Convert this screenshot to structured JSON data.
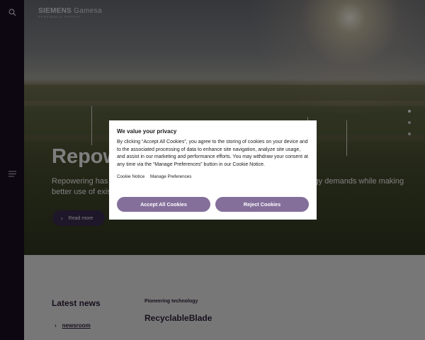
{
  "logo": {
    "brand_bold": "SIEMENS",
    "brand_light": "Gamesa",
    "tagline": "RENEWABLE ENERGY"
  },
  "sidebar": {
    "search_icon": "search-icon",
    "menu_icon": "menu-icon"
  },
  "hero": {
    "title": "Repowering",
    "text": "Repowering has become a key lever in meeting the growing renewable energy demands while making better use of existing wind sites.",
    "read_more": "Read more",
    "slides_count": 3,
    "active_slide": 1
  },
  "news": {
    "heading": "Latest news",
    "newsroom_link": "newsroom",
    "eyebrow": "Pioneering technology",
    "article_title": "RecyclableBlade"
  },
  "cookie_modal": {
    "title": "We value your privacy",
    "body": "By clicking “Accept All Cookies”, you agree to the storing of cookies on your device and to the associated processing of data to enhance site navigation, analyze site usage, and assist in our marketing and performance efforts. You may withdraw your consent at any time via the “Manage Preferences” button in our Cookie Notice.",
    "link_cookie_notice": "Cookie Notice",
    "link_manage": "Manage Preferences",
    "accept_label": "Accept All Cookies",
    "reject_label": "Reject Cookies"
  },
  "colors": {
    "sidebar": "#1b0f24",
    "button": "#846f9b",
    "text_dark": "#2d1e3c"
  }
}
